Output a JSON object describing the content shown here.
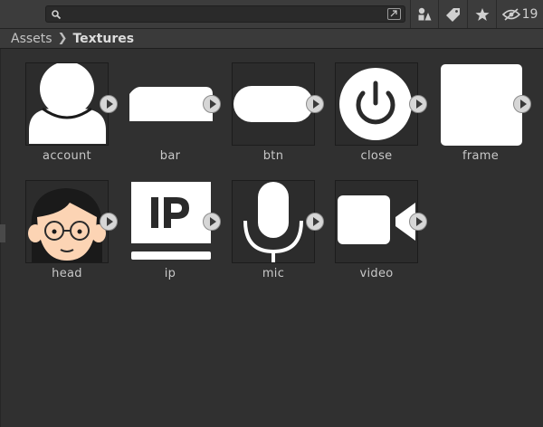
{
  "toolbar": {
    "search": {
      "value": "",
      "placeholder": ""
    },
    "hidden_count": "19"
  },
  "breadcrumb": {
    "parent": "Assets",
    "current": "Textures"
  },
  "assets": [
    {
      "label": "account",
      "icon": "account-icon"
    },
    {
      "label": "bar",
      "icon": "bar-icon"
    },
    {
      "label": "btn",
      "icon": "btn-icon"
    },
    {
      "label": "close",
      "icon": "power-icon"
    },
    {
      "label": "frame",
      "icon": "frame-icon"
    },
    {
      "label": "head",
      "icon": "head-icon"
    },
    {
      "label": "ip",
      "icon": "ip-icon"
    },
    {
      "label": "mic",
      "icon": "mic-icon"
    },
    {
      "label": "video",
      "icon": "video-camera-icon"
    }
  ],
  "colors": {
    "background": "#303030",
    "toolbar": "#3c3c3c",
    "thumbnail_fg": "#ffffff",
    "head_skin": "#fcd4b4",
    "head_hair": "#1a1a1a"
  }
}
